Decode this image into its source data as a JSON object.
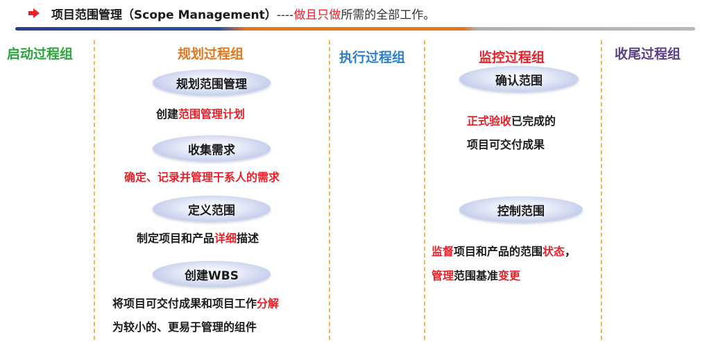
{
  "header": {
    "title_main": "项目范围管理（Scope Management）",
    "title_dash": "----",
    "title_emphasis": "做且只做",
    "title_rest": "所需的全部工作。"
  },
  "colors": {
    "red": "#e8202a",
    "green": "#2aa43b",
    "orange": "#e6761c",
    "blue": "#2b7fd0",
    "purple": "#5a3f88",
    "divider": "#f0b84e",
    "oval_fill": "#aab7e3"
  },
  "icons": {
    "bullet": "arrow-right-icon"
  },
  "columns": [
    {
      "label": "启动过程组"
    },
    {
      "label": "规划过程组"
    },
    {
      "label": "执行过程组"
    },
    {
      "label": "监控过程组"
    },
    {
      "label": "收尾过程组"
    }
  ],
  "planning": {
    "processes": [
      {
        "label": "规划范围管理",
        "desc": [
          {
            "text": "创建",
            "hl": false
          },
          {
            "text": "范围管理计划",
            "hl": true
          }
        ]
      },
      {
        "label": "收集需求",
        "desc": [
          {
            "text": "确定、记录并管理干系人的需求",
            "hl": true
          }
        ]
      },
      {
        "label": "定义范围",
        "desc": [
          {
            "text": "制定项目和产品",
            "hl": false
          },
          {
            "text": "详细",
            "hl": true
          },
          {
            "text": "描述",
            "hl": false
          }
        ]
      },
      {
        "label": "创建WBS",
        "desc1": [
          {
            "text": "将项目可交付成果和项目工作",
            "hl": false
          },
          {
            "text": "分解",
            "hl": true
          }
        ],
        "desc2": [
          {
            "text": "为较小的、更易于管理的组件",
            "hl": false
          }
        ]
      }
    ]
  },
  "monitoring": {
    "processes": [
      {
        "label": "确认范围",
        "desc1": [
          {
            "text": "正式验收",
            "hl": true
          },
          {
            "text": "已完成的",
            "hl": false
          }
        ],
        "desc2": [
          {
            "text": "项目可交付成果",
            "hl": false
          }
        ]
      },
      {
        "label": "控制范围",
        "desc1": [
          {
            "text": "监督",
            "hl": true
          },
          {
            "text": "项目和产品的范围",
            "hl": false
          },
          {
            "text": "状态",
            "hl": true
          },
          {
            "text": "，",
            "hl": false
          }
        ],
        "desc2": [
          {
            "text": "管理",
            "hl": true
          },
          {
            "text": "范围基准",
            "hl": false
          },
          {
            "text": "变更",
            "hl": true
          }
        ]
      }
    ]
  }
}
